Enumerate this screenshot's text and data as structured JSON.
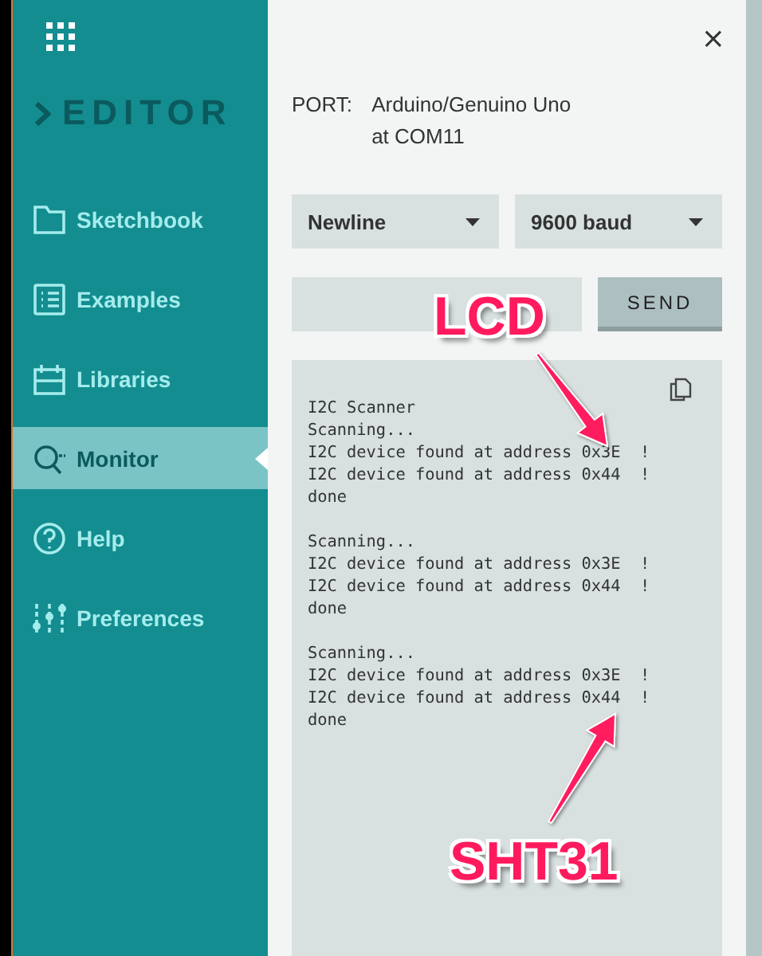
{
  "sidebar": {
    "logo": "EDITOR",
    "items": [
      {
        "kind": "folder",
        "label": "Sketchbook",
        "selected": false
      },
      {
        "kind": "list",
        "label": "Examples",
        "selected": false
      },
      {
        "kind": "calendar",
        "label": "Libraries",
        "selected": false
      },
      {
        "kind": "monitor",
        "label": "Monitor",
        "selected": true
      },
      {
        "kind": "help",
        "label": "Help",
        "selected": false
      },
      {
        "kind": "sliders",
        "label": "Preferences",
        "selected": false
      }
    ]
  },
  "panel": {
    "close": "×",
    "port_label": "PORT:",
    "port_value": "Arduino/Genuino Uno at COM11",
    "line_ending": "Newline",
    "baud": "9600 baud",
    "send": "SEND",
    "output": [
      [
        "I2C Scanner",
        "Scanning...",
        "I2C device found at address 0x3E  !",
        "I2C device found at address 0x44  !",
        "done"
      ],
      [
        "Scanning...",
        "I2C device found at address 0x3E  !",
        "I2C device found at address 0x44  !",
        "done"
      ],
      [
        "Scanning...",
        "I2C device found at address 0x3E  !",
        "I2C device found at address 0x44  !",
        "done"
      ]
    ]
  },
  "annotations": [
    {
      "text": "LCD"
    },
    {
      "text": "SHT31"
    }
  ]
}
